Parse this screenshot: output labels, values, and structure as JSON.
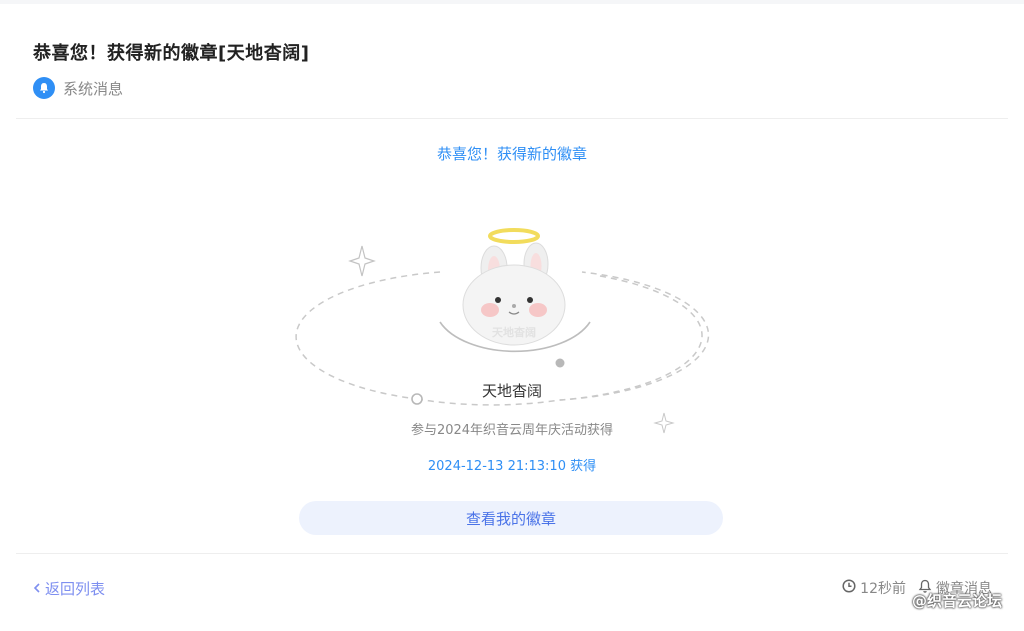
{
  "header": {
    "title": "恭喜您！获得新的徽章[天地杳阔]",
    "source_label": "系统消息"
  },
  "badge": {
    "subtitle": "恭喜您！获得新的徽章",
    "name": "天地杳阔",
    "description": "参与2024年织音云周年庆活动获得",
    "obtained_time": "2024-12-13 21:13:10 获得",
    "view_button_label": "查看我的徽章",
    "art_text": "天地杳阔"
  },
  "footer": {
    "back_label": "返回列表",
    "relative_time": "12秒前",
    "category_label": "徽章消息"
  },
  "watermark": "@织音云论坛",
  "colors": {
    "accent": "#2f8ff5",
    "button_bg": "#edf2fd",
    "button_text": "#4a73e8",
    "link": "#7e8ff0"
  },
  "icons": [
    "bell-icon",
    "clock-icon",
    "chevron-left-icon",
    "sparkle-icon",
    "bunny-badge-icon"
  ]
}
